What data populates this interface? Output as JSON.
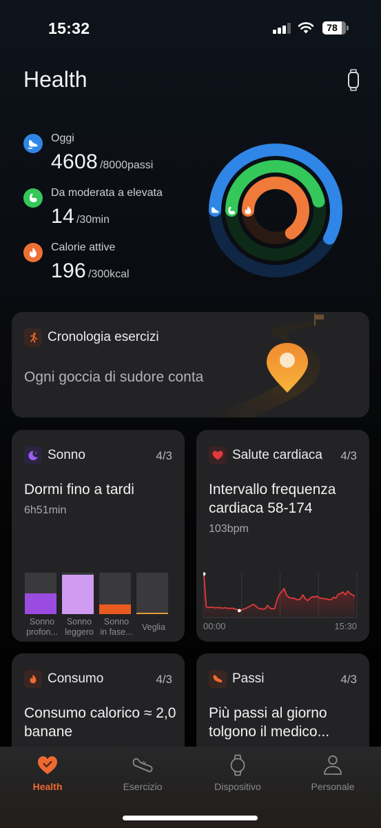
{
  "status_bar": {
    "time": "15:32",
    "battery_level": "78",
    "signal_bars": 3
  },
  "header": {
    "title": "Health",
    "watch_icon": "smartwatch-icon"
  },
  "summary": {
    "metrics": [
      {
        "label": "Oggi",
        "value": "4608",
        "goal": "/8000passi",
        "icon": "shoe-icon",
        "color": "#2f86e6",
        "current": 4608,
        "target": 8000
      },
      {
        "label": "Da moderata a elevata",
        "value": "14",
        "goal": "/30min",
        "icon": "flexed-arm-icon",
        "color": "#34c759",
        "current": 14,
        "target": 30
      },
      {
        "label": "Calorie attive",
        "value": "196",
        "goal": "/300kcal",
        "icon": "flame-icon",
        "color": "#ef7035",
        "current": 196,
        "target": 300
      }
    ]
  },
  "colors": {
    "accent": "#ee6a32",
    "steps": "#2f86e6",
    "intensity": "#34c759",
    "calories": "#f07a3a",
    "card_bg": "#232325",
    "sleep_deep": "#9a4be0",
    "sleep_light": "#cf9cf2",
    "sleep_rem": "#e85a20",
    "sleep_awake": "#e39a3a",
    "heart": "#e03a3a"
  },
  "exercise_card": {
    "title": "Cronologia esercizi",
    "motto": "Ogni goccia di sudore conta",
    "icon": "running-person-icon"
  },
  "sleep_card": {
    "title": "Sonno",
    "date": "4/3",
    "headline": "Dormi fino a tardi",
    "duration": "6h51min",
    "icon": "moon-icon",
    "stages": [
      {
        "label": "Sonno profon...",
        "line1": "Sonno",
        "line2": "profon...",
        "fraction": 0.5
      },
      {
        "label": "Sonno leggero",
        "line1": "Sonno",
        "line2": "leggero",
        "fraction": 0.95
      },
      {
        "label": "Sonno in fase...",
        "line1": "Sonno",
        "line2": "in fase...",
        "fraction": 0.23
      },
      {
        "label": "Veglia",
        "line1": "",
        "line2": "Veglia",
        "fraction": 0.03
      }
    ]
  },
  "heart_card": {
    "title": "Salute cardiaca",
    "date": "4/3",
    "headline": "Intervallo frequenza cardiaca 58-174",
    "current": "103bpm",
    "icon": "heart-icon",
    "x_start": "00:00",
    "x_end": "15:30",
    "min_bpm": 58,
    "max_bpm": 174,
    "series": [
      174,
      70,
      68,
      69,
      68,
      67,
      68,
      67,
      66,
      67,
      66,
      65,
      66,
      64,
      62,
      58,
      61,
      63,
      66,
      70,
      74,
      78,
      72,
      66,
      64,
      63,
      64,
      75,
      66,
      64,
      65,
      92,
      110,
      118,
      128,
      108,
      100,
      97,
      98,
      94,
      92,
      96,
      108,
      95,
      90,
      97,
      102,
      101,
      104,
      98,
      97,
      96,
      95,
      92,
      93,
      100,
      98,
      110,
      112,
      117,
      108,
      120,
      112,
      108,
      103
    ]
  },
  "burn_card": {
    "title": "Consumo",
    "date": "4/3",
    "headline": "Consumo calorico ≈ 2,0 banane",
    "icon": "flame-icon"
  },
  "steps_card": {
    "title": "Passi",
    "date": "4/3",
    "headline": "Più passi al giorno tolgono il medico...",
    "icon": "shoe-icon"
  },
  "tabbar": {
    "tabs": [
      {
        "label": "Health",
        "icon": "heart-check-icon",
        "active": true
      },
      {
        "label": "Esercizio",
        "icon": "sneaker-icon",
        "active": false
      },
      {
        "label": "Dispositivo",
        "icon": "watch-icon",
        "active": false
      },
      {
        "label": "Personale",
        "icon": "person-icon",
        "active": false
      }
    ]
  }
}
